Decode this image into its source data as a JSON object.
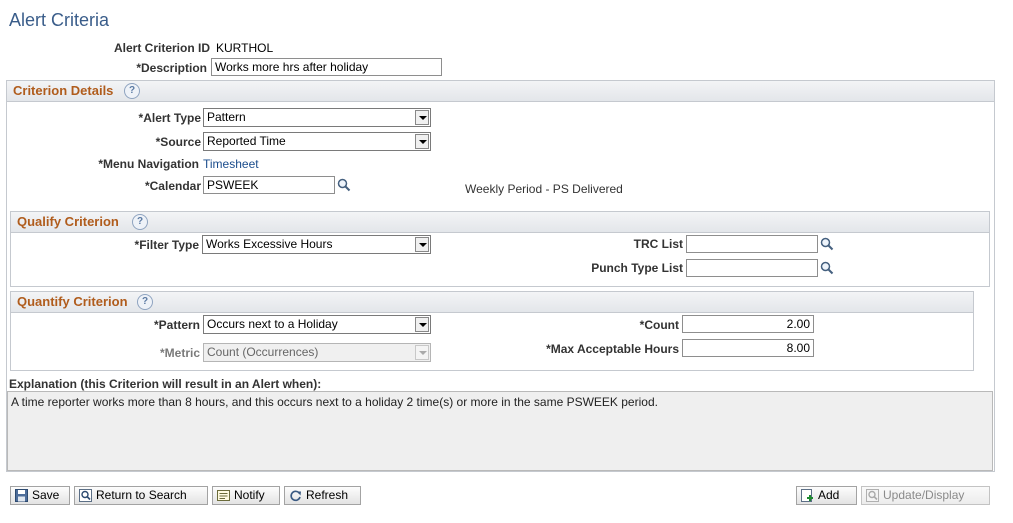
{
  "page": {
    "title": "Alert Criteria"
  },
  "header": {
    "criterion_id_label": "Alert Criterion ID",
    "criterion_id_value": "KURTHOL",
    "description_label": "*Description",
    "description_value": "Works more hrs after holiday"
  },
  "criterion_details": {
    "title": "Criterion Details",
    "alert_type_label": "*Alert Type",
    "alert_type_value": "Pattern",
    "source_label": "*Source",
    "source_value": "Reported Time",
    "menu_navigation_label": "*Menu Navigation",
    "menu_navigation_value": "Timesheet",
    "calendar_label": "*Calendar",
    "calendar_value": "PSWEEK",
    "calendar_description": "Weekly Period - PS Delivered"
  },
  "qualify_criterion": {
    "title": "Qualify Criterion",
    "filter_type_label": "*Filter Type",
    "filter_type_value": "Works Excessive Hours",
    "trc_list_label": "TRC List",
    "trc_list_value": "",
    "punch_type_list_label": "Punch Type List",
    "punch_type_list_value": ""
  },
  "quantify_criterion": {
    "title": "Quantify Criterion",
    "pattern_label": "*Pattern",
    "pattern_value": "Occurs next to a Holiday",
    "metric_label": "*Metric",
    "metric_value": "Count (Occurrences)",
    "count_label": "*Count",
    "count_value": "2.00",
    "max_hours_label": "*Max Acceptable Hours",
    "max_hours_value": "8.00"
  },
  "explanation": {
    "label": "Explanation (this Criterion will result in an Alert when):",
    "text": "A time reporter works more than 8 hours, and this occurs next to a holiday 2 time(s) or more in the same PSWEEK period."
  },
  "toolbar": {
    "save": "Save",
    "return_to_search": "Return to Search",
    "notify": "Notify",
    "refresh": "Refresh",
    "add": "Add",
    "update_display": "Update/Display"
  },
  "colors": {
    "title": "#3a5d8a",
    "section_title": "#b05c1c",
    "link": "#1a4c8c"
  },
  "icons": {
    "help": "?",
    "lookup": "magnifier-icon"
  }
}
